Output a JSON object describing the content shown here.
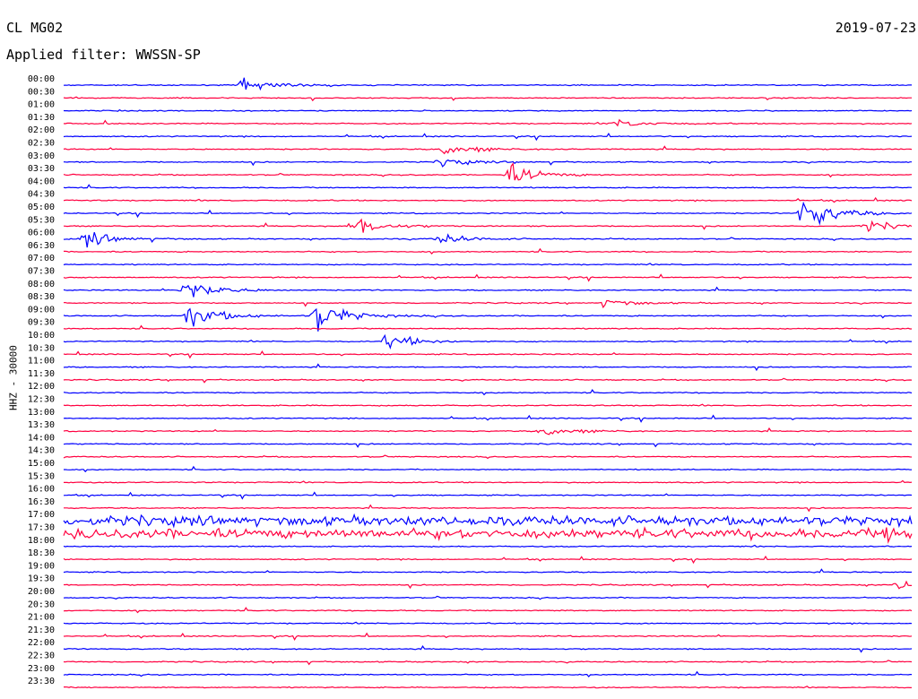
{
  "header": {
    "station": "CL MG02",
    "filter": "Applied filter: WWSSN-SP",
    "date": "2019-07-23"
  },
  "chart_data": {
    "type": "line",
    "title": "CL MG02",
    "subtitle": "Applied filter: WWSSN-SP",
    "date": "2019-07-23",
    "ylabel": "HHZ - 30000",
    "colors": [
      "#0000ff",
      "#ff0040"
    ],
    "row_labels": [
      "00:00",
      "00:30",
      "01:00",
      "01:30",
      "02:00",
      "02:30",
      "03:00",
      "03:30",
      "04:00",
      "04:30",
      "05:00",
      "05:30",
      "06:00",
      "06:30",
      "07:00",
      "07:30",
      "08:00",
      "08:30",
      "09:00",
      "09:30",
      "10:00",
      "10:30",
      "11:00",
      "11:30",
      "12:00",
      "12:30",
      "13:00",
      "13:30",
      "14:00",
      "14:30",
      "15:00",
      "15:30",
      "16:00",
      "16:30",
      "17:00",
      "17:30",
      "18:00",
      "18:30",
      "19:00",
      "19:30",
      "20:00",
      "20:30",
      "21:00",
      "21:30",
      "22:00",
      "22:30",
      "23:00",
      "23:30"
    ],
    "grid": false,
    "events": [
      {
        "row": 0,
        "x_min": 6.4,
        "amp": 3
      },
      {
        "row": 3,
        "x_min": 19.5,
        "amp": 1.5
      },
      {
        "row": 5,
        "x_min": 13.5,
        "amp": 2.5
      },
      {
        "row": 6,
        "x_min": 13.4,
        "amp": 1.5
      },
      {
        "row": 7,
        "x_min": 15.8,
        "amp": 4
      },
      {
        "row": 10,
        "x_min": 26.2,
        "amp": 7
      },
      {
        "row": 11,
        "x_min": 10.3,
        "amp": 4
      },
      {
        "row": 11,
        "x_min": 28.4,
        "amp": 2
      },
      {
        "row": 12,
        "x_min": 0.8,
        "amp": 3
      },
      {
        "row": 12,
        "x_min": 13.3,
        "amp": 2
      },
      {
        "row": 16,
        "x_min": 4.3,
        "amp": 5
      },
      {
        "row": 17,
        "x_min": 19.2,
        "amp": 1.5
      },
      {
        "row": 18,
        "x_min": 4.5,
        "amp": 5
      },
      {
        "row": 18,
        "x_min": 9.0,
        "amp": 6
      },
      {
        "row": 20,
        "x_min": 11.5,
        "amp": 3
      },
      {
        "row": 27,
        "x_min": 17.0,
        "amp": 2
      },
      {
        "row": 35,
        "x_min": 29.2,
        "amp": 3
      },
      {
        "row": 39,
        "x_min": 29.6,
        "amp": 2
      }
    ]
  }
}
